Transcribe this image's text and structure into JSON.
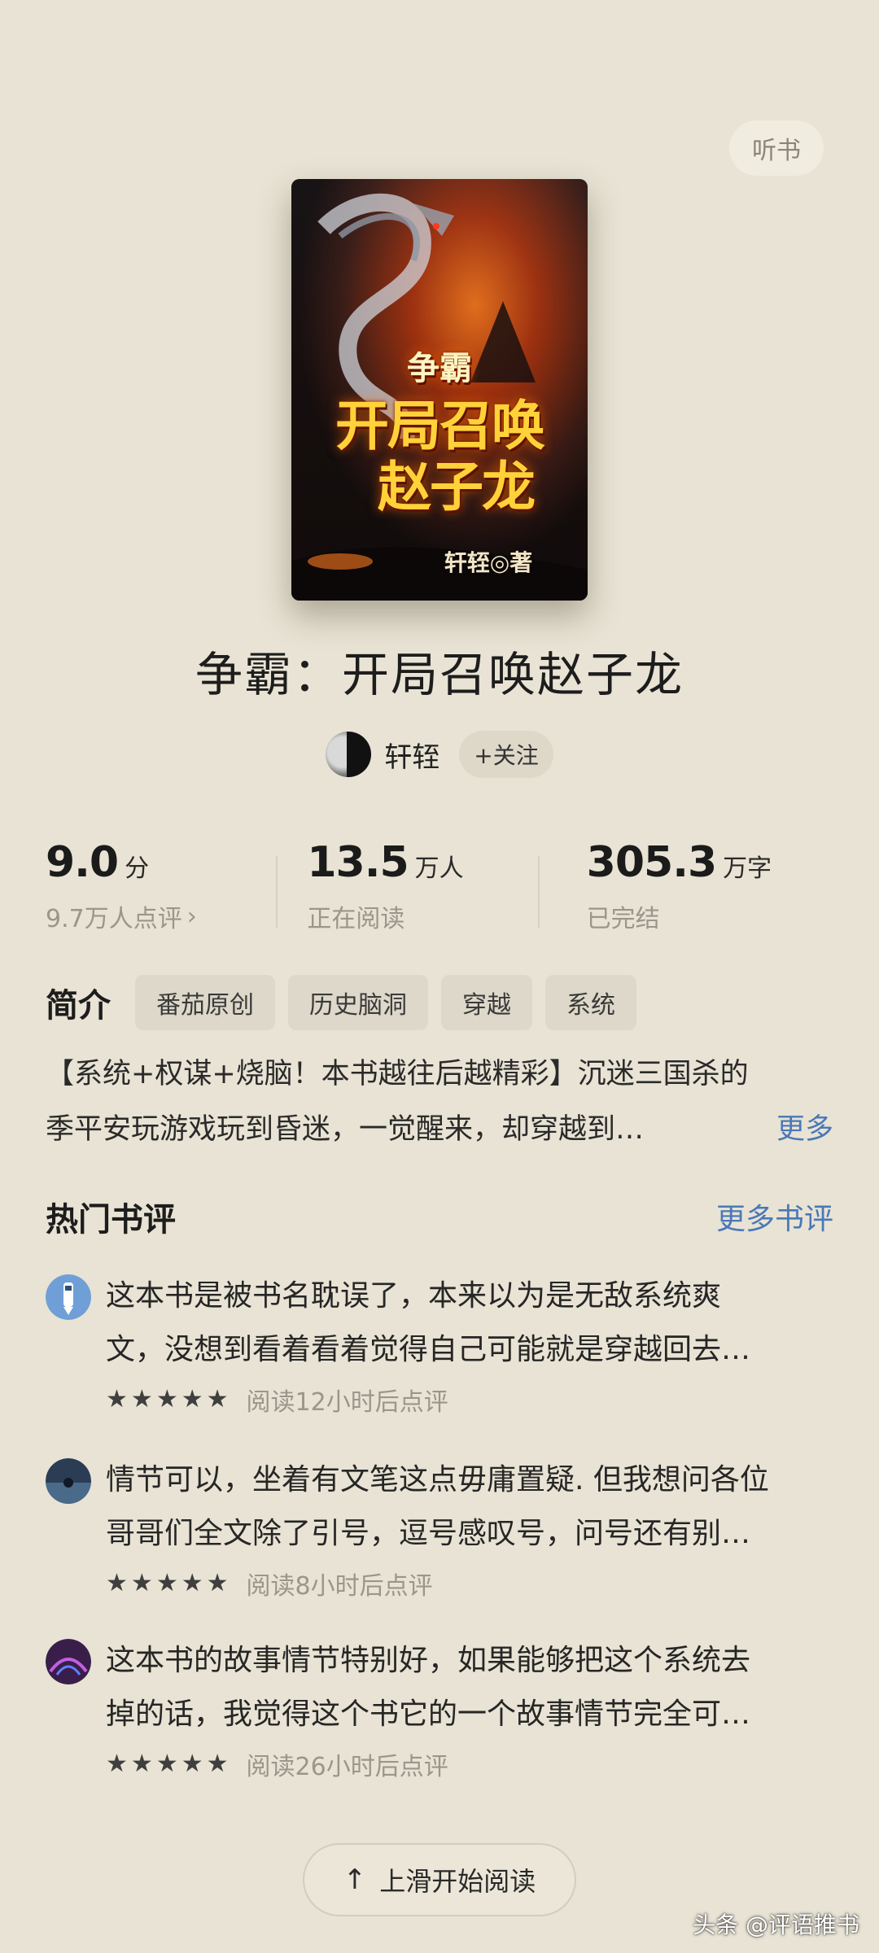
{
  "listen_label": "听书",
  "cover": {
    "series": "争霸",
    "title_line1": "开局召唤",
    "title_line2": "赵子龙",
    "author_stamp": "轩轾◎著"
  },
  "book_title": "争霸：开局召唤赵子龙",
  "author": {
    "name": "轩轾",
    "follow_label": "+关注"
  },
  "stats": [
    {
      "value": "9.0",
      "unit": "分",
      "sub": "9.7万人点评",
      "sub_icon": "chevron-right"
    },
    {
      "value": "13.5",
      "unit": "万人",
      "sub": "正在阅读"
    },
    {
      "value": "305.3",
      "unit": "万字",
      "sub": "已完结"
    }
  ],
  "intro": {
    "label": "简介",
    "tags": [
      "番茄原创",
      "历史脑洞",
      "穿越",
      "系统"
    ],
    "line1": "【系统+权谋+烧脑！本书越往后越精彩】沉迷三国杀的",
    "line2": "季平安玩游戏玩到昏迷，一觉醒来，却穿越到…",
    "more": "更多"
  },
  "reviews": {
    "title": "热门书评",
    "more": "更多书评",
    "items": [
      {
        "line1": "这本书是被书名耽误了，本来以为是无敌系统爽",
        "line2": "文，没想到看着看着觉得自己可能就是穿越回去…",
        "stars": 5,
        "time": "阅读12小时后点评"
      },
      {
        "line1": "情节可以，坐着有文笔这点毋庸置疑. 但我想问各位",
        "line2": "哥哥们全文除了引号，逗号感叹号，问号还有别…",
        "stars": 5,
        "time": "阅读8小时后点评"
      },
      {
        "line1": "这本书的故事情节特别好，如果能够把这个系统去",
        "line2": "掉的话，我觉得这个书它的一个故事情节完全可…",
        "stars": 5,
        "time": "阅读26小时后点评"
      }
    ]
  },
  "start_reading": "上滑开始阅读",
  "start_icon": "arrow-up",
  "watermark": "头条 @评语推书"
}
